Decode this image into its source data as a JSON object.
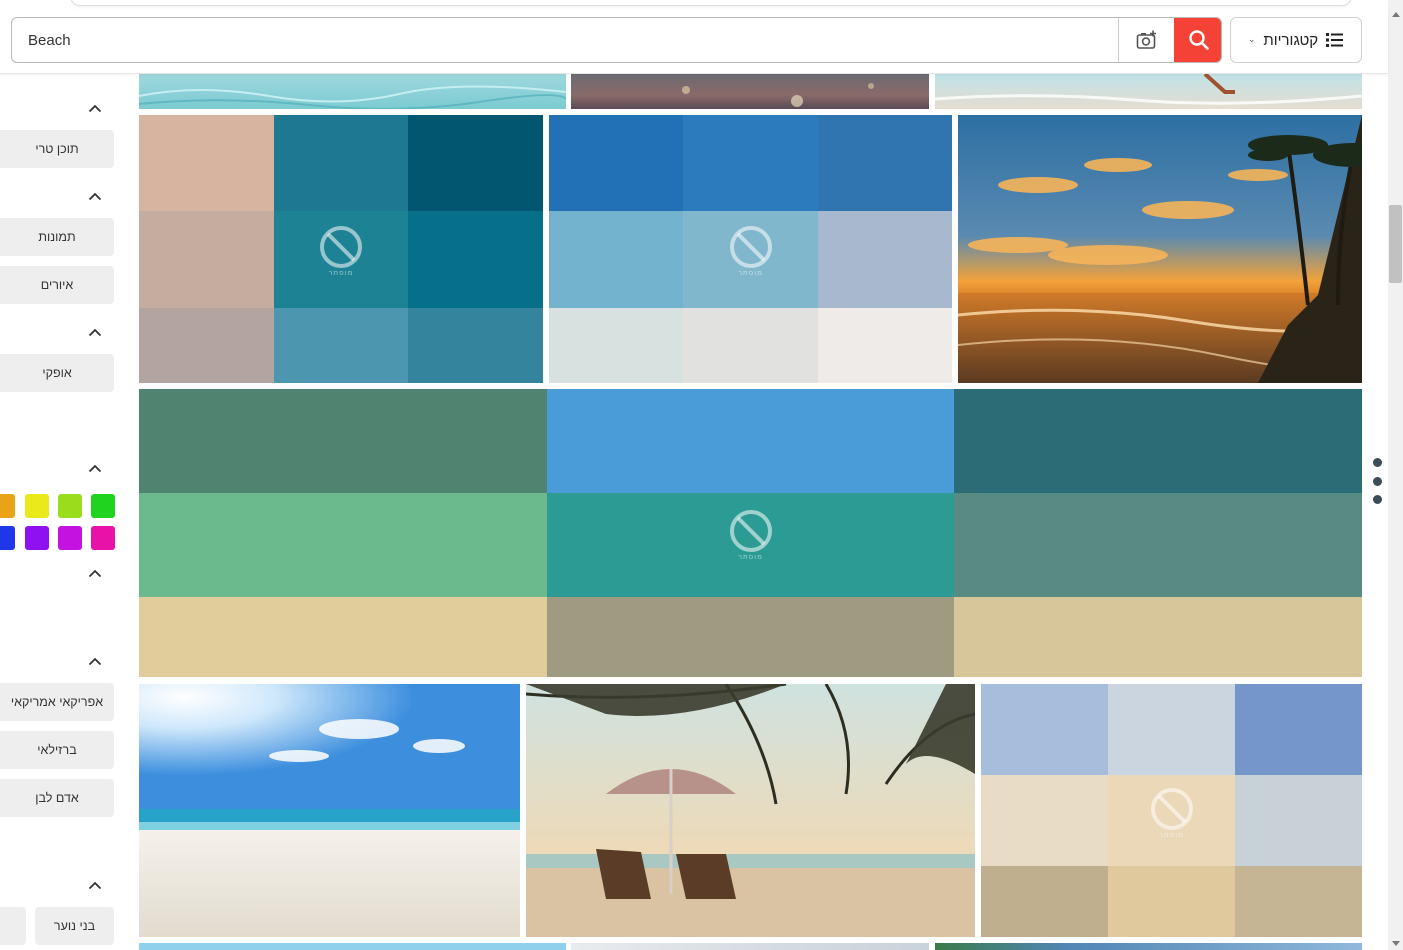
{
  "search": {
    "value": "Beach",
    "placeholder": ""
  },
  "header": {
    "categories_label": "קטגוריות",
    "camera_icon": "camera-plus-icon",
    "search_icon": "magnifier-icon",
    "list_icon": "list-icon"
  },
  "sidebar": {
    "content_type": [
      "תוכן טרי"
    ],
    "image_types": [
      "תמונות",
      "איורים"
    ],
    "orientation": [
      "אופקי"
    ],
    "colors": [
      "#e8a317",
      "#e9e91c",
      "#9bdc1c",
      "#1fd31f",
      "#1f37e8",
      "#8f10f0",
      "#c412e0",
      "#e812a8"
    ],
    "ethnicity": [
      "אפריקאי אמריקאי",
      "ברזילאי",
      "אדם לבן"
    ],
    "age": [
      "בני נוער"
    ]
  },
  "content": {
    "placeholder_caption": "מוסתר",
    "palettes": {
      "tile_a": [
        [
          "#d6b4a0",
          "#1f7891",
          "#02566f"
        ],
        [
          "#c4ad9f",
          "#1d8293",
          "#066f89"
        ],
        [
          "#b4a49f",
          "#4c96b0",
          "#35849d"
        ]
      ],
      "tile_b": [
        [
          "#2270b6",
          "#2b7bbd",
          "#3175b0"
        ],
        [
          "#74b3cd",
          "#80b7cd",
          "#a8b9cf"
        ],
        [
          "#d7e1e0",
          "#e1e1e0",
          "#efebe8"
        ]
      ],
      "tile_c": [
        [
          "#508370",
          "#4a9cd8",
          "#2c6c77"
        ],
        [
          "#6bba8e",
          "#2b9b93",
          "#5a8b82"
        ],
        [
          "#e1cc9b",
          "#9e9b80",
          "#d6c699"
        ]
      ],
      "tile_d": [
        [
          "#a6bedb",
          "#cad5e0",
          "#7596c9"
        ],
        [
          "#e8dcc6",
          "#ead8b8",
          "#c8d0d8"
        ],
        [
          "#bfaf8f",
          "#dfc99d",
          "#c6b594"
        ]
      ]
    }
  }
}
